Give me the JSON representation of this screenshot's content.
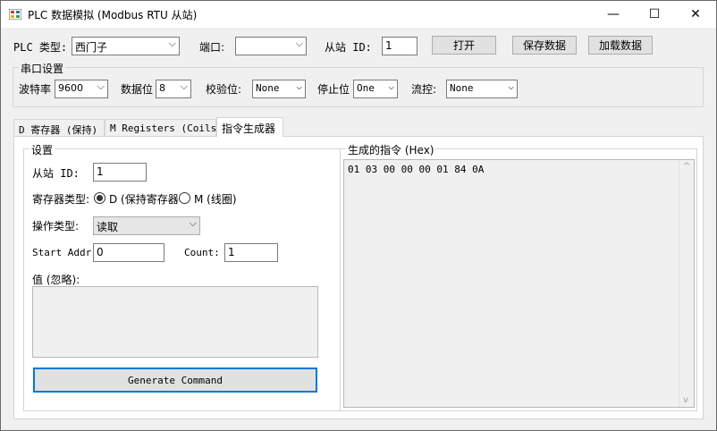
{
  "window": {
    "title": "PLC 数据模拟 (Modbus RTU 从站)",
    "minimize": "—",
    "maximize": "☐",
    "close": "✕"
  },
  "toolbar": {
    "plc_type_label": "PLC 类型:",
    "plc_type_value": "西门子",
    "port_label": "端口:",
    "port_value": "",
    "slave_id_label": "从站 ID:",
    "slave_id_value": "1",
    "open_button": "打开",
    "save_button": "保存数据",
    "load_button": "加载数据"
  },
  "serial": {
    "group_title": "串口设置",
    "baud_label": "波特率",
    "baud_value": "9600",
    "databits_label": "数据位",
    "databits_value": "8",
    "parity_label": "校验位:",
    "parity_value": "None",
    "stopbits_label": "停止位",
    "stopbits_value": "One",
    "flow_label": "流控:",
    "flow_value": "None"
  },
  "tabs": [
    {
      "label": "D 寄存器 (保持)"
    },
    {
      "label": "M Registers (Coils)"
    },
    {
      "label": "指令生成器"
    }
  ],
  "settings": {
    "group_title": "设置",
    "slave_id_label": "从站 ID:",
    "slave_id_value": "1",
    "reg_type_label": "寄存器类型:",
    "reg_type_d": "D (保持寄存器",
    "reg_type_m": "M (线圈)",
    "op_type_label": "操作类型:",
    "op_type_value": "读取",
    "start_addr_label": "Start Addr:",
    "start_addr_value": "0",
    "count_label": "Count:",
    "count_value": "1",
    "value_label": "值 (忽略):",
    "value_text": "",
    "generate_button": "Generate Command"
  },
  "output": {
    "group_title": "生成的指令 (Hex)",
    "hex": "01 03 00 00 00 01 84 0A",
    "scroll_up": "^",
    "scroll_down": "v"
  }
}
